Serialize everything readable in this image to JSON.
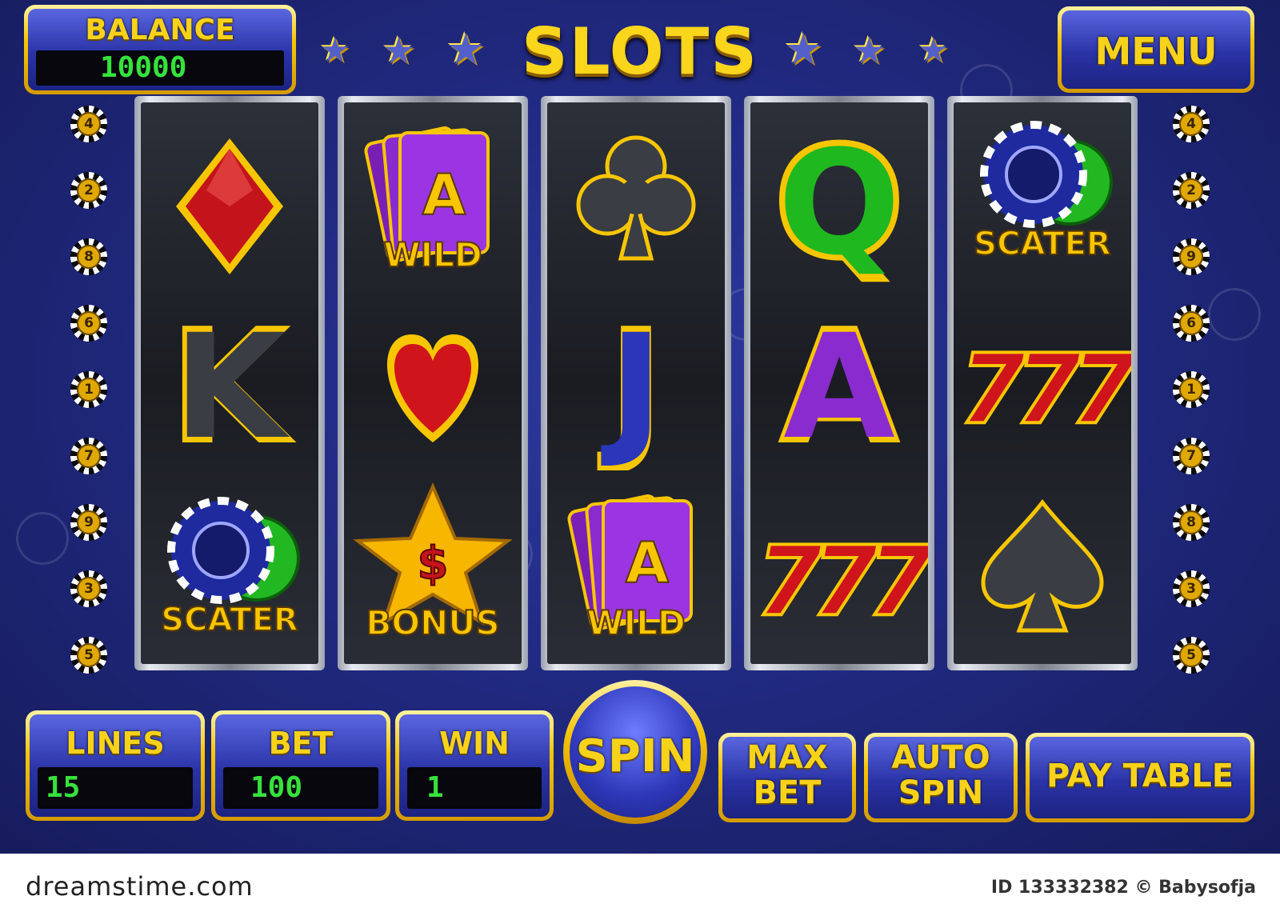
{
  "title": "SLOTS",
  "balance": {
    "label": "BALANCE",
    "value": "10000"
  },
  "menu_label": "MENU",
  "left_line_numbers": [
    "4",
    "2",
    "8",
    "6",
    "1",
    "7",
    "9",
    "3",
    "5"
  ],
  "right_line_numbers": [
    "4",
    "2",
    "9",
    "6",
    "1",
    "7",
    "8",
    "3",
    "5"
  ],
  "reels": [
    [
      {
        "symbol": "diamond",
        "text": ""
      },
      {
        "symbol": "K",
        "text": "K"
      },
      {
        "symbol": "chips",
        "text": "SCATER"
      }
    ],
    [
      {
        "symbol": "wild",
        "text": "WILD",
        "card_letter": "A"
      },
      {
        "symbol": "heart",
        "text": ""
      },
      {
        "symbol": "bonus-star",
        "text": "BONUS",
        "mark": "$"
      }
    ],
    [
      {
        "symbol": "club",
        "text": ""
      },
      {
        "symbol": "J",
        "text": "J"
      },
      {
        "symbol": "wild",
        "text": "WILD",
        "card_letter": "A"
      }
    ],
    [
      {
        "symbol": "Q",
        "text": "Q"
      },
      {
        "symbol": "A",
        "text": "A"
      },
      {
        "symbol": "sevens",
        "text": "777"
      }
    ],
    [
      {
        "symbol": "chips",
        "text": "SCATER"
      },
      {
        "symbol": "sevens",
        "text": "777"
      },
      {
        "symbol": "spade",
        "text": ""
      }
    ]
  ],
  "controls": {
    "lines": {
      "label": "LINES",
      "value": "15"
    },
    "bet": {
      "label": "BET",
      "value": "100"
    },
    "win": {
      "label": "WIN",
      "value": "1"
    },
    "spin": "SPIN",
    "max_bet": [
      "MAX",
      "BET"
    ],
    "auto_spin": [
      "AUTO",
      "SPIN"
    ],
    "pay_table": "PAY TABLE"
  },
  "footer": {
    "site": "dreamstime.com",
    "id_text": "ID 133332382 © Babysofja"
  },
  "colors": {
    "gold": "#f7d21a",
    "blue_bg": "#222b85",
    "display_green": "#36e23c",
    "red": "#d91c1c",
    "purple": "#8a2bd0",
    "green": "#1fb81f"
  }
}
